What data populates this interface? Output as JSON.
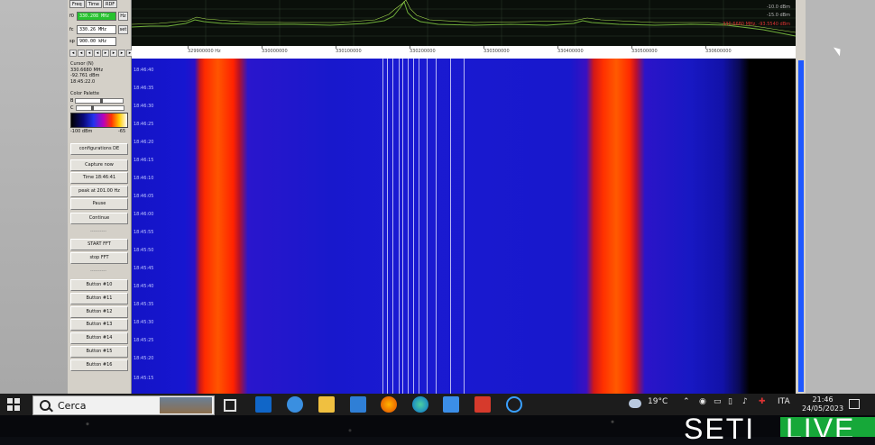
{
  "tabs": [
    "Freq",
    "Time",
    "RDF"
  ],
  "freq_fields": {
    "f0_label": "f0",
    "f0_value": "330.208 MHz",
    "fc_label": "fc",
    "fc_value": "330.26 MHz",
    "fc_button": "set",
    "sp_label": "sp",
    "sp_value": "900.00 kHz"
  },
  "cursor_info": {
    "title": "Cursor (N)",
    "freq": "330.6680 MHz",
    "power": "-92.761 dBm",
    "time": "18:45:22.0"
  },
  "palette": {
    "title": "Color Palette",
    "b_label": "B",
    "c_label": "C",
    "b_level": 0.55,
    "c_level": 0.35,
    "min_label": "-100 dBm",
    "max_label": "-65"
  },
  "buttons": {
    "config": "configurations DE",
    "capture": "Capture now",
    "time": "Time 18:46:41",
    "peak": "peak at 201.00 Hz",
    "pause": "Pause",
    "continue": "Continue",
    "start_fft": "START FFT",
    "stop_fft": "stop FFT",
    "b10": "Button #10",
    "b11": "Button #11",
    "b12": "Button #12",
    "b13": "Button #13",
    "b14": "Button #14",
    "b15": "Button #15",
    "b16": "Button #16"
  },
  "separator": "----------",
  "spectrum": {
    "readout": "330.6680 MHz, -93.5540 dBm",
    "db_top": "-10.0 dBm",
    "db_mid": "-15.0 dBm"
  },
  "freq_ticks": [
    "329900000 Hz",
    "330000000",
    "330100000",
    "330200000",
    "330300000",
    "330400000",
    "330500000",
    "330600000"
  ],
  "time_labels": [
    "18:46:40",
    "18:46:35",
    "18:46:30",
    "18:46:25",
    "18:46:20",
    "18:46:15",
    "18:46:10",
    "18:46:05",
    "18:46:00",
    "18:45:55",
    "18:45:50",
    "18:45:45",
    "18:45:40",
    "18:45:35",
    "18:45:30",
    "18:45:25",
    "18:45:20",
    "18:45:15"
  ],
  "taskbar": {
    "search_placeholder": "Cerca",
    "weather": "19°C",
    "lang": "ITA",
    "time": "21:46",
    "date": "24/05/2023"
  },
  "overlay_brand": {
    "left": "SETI",
    "right": "LIVE"
  },
  "colors": {
    "accent_green": "#27c22f",
    "live_green": "#16a839",
    "scroll_blue": "#1e58ff"
  }
}
